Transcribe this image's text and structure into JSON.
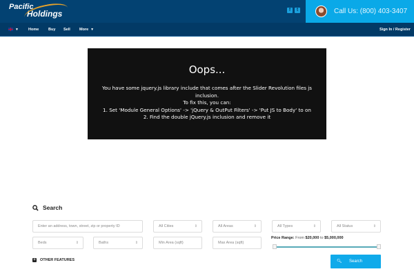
{
  "header": {
    "logo_line1": "Pacific",
    "logo_line2": "Holdings",
    "social": [
      "facebook-icon",
      "twitter-icon"
    ],
    "call_text": "Call Us: (800) 403-3407"
  },
  "nav": {
    "items": [
      "Home",
      "Buy",
      "Sell",
      "More"
    ],
    "signin": "Sign In / Register"
  },
  "error": {
    "title": "Oops...",
    "line1": "You have some jquery.js library include that comes after the Slider Revolution files js inclusion.",
    "line2": "To fix this, you can:",
    "line3": "1. Set 'Module General Options' -> 'jQuery & OutPut Filters' -> 'Put JS to Body' to on",
    "line4": "2. Find the double jQuery.js inclusion and remove it"
  },
  "search": {
    "title": "Search",
    "address_placeholder": "Enter an address, town, street, zip or property ID",
    "cities": "All Cities",
    "areas": "All Areas",
    "types": "All Types",
    "status": "All Status",
    "beds": "Beds",
    "baths": "Baths",
    "min_area": "Min Area (sqft)",
    "max_area": "Max Area (sqft)",
    "price_label": "Price Range:",
    "price_from_word": "From",
    "price_min": "$20,000",
    "price_to_word": "to",
    "price_max": "$5,000,000",
    "other_features": "OTHER FEATURES",
    "button": "Search"
  }
}
